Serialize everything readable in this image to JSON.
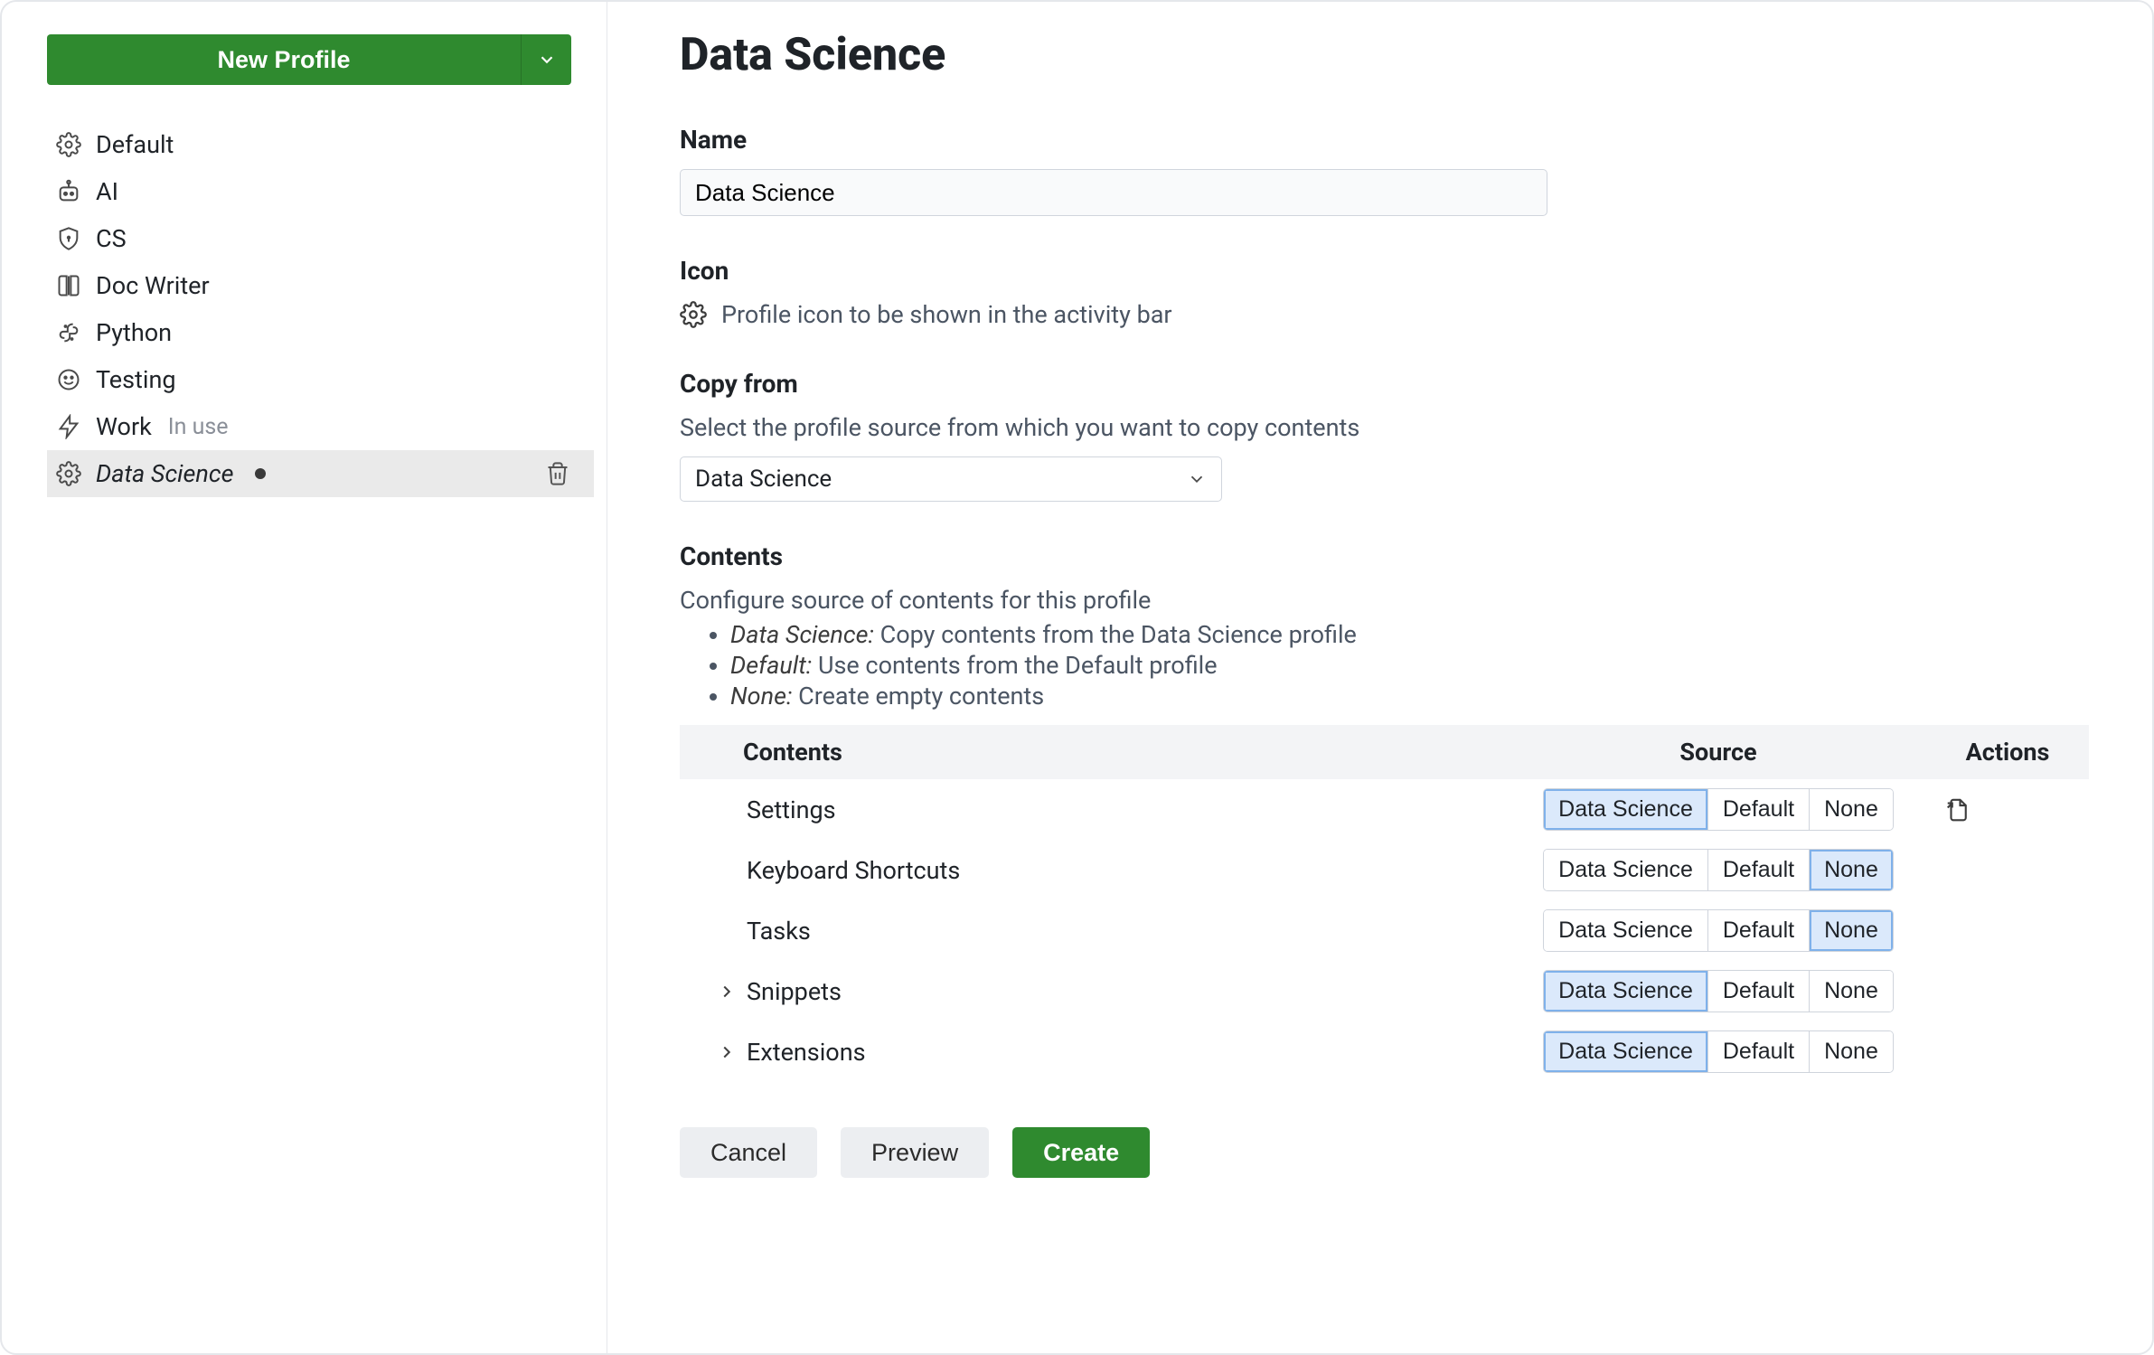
{
  "sidebar": {
    "newProfileLabel": "New Profile",
    "items": [
      {
        "label": "Default",
        "icon": "gear"
      },
      {
        "label": "AI",
        "icon": "robot"
      },
      {
        "label": "CS",
        "icon": "shield"
      },
      {
        "label": "Doc Writer",
        "icon": "book"
      },
      {
        "label": "Python",
        "icon": "snake"
      },
      {
        "label": "Testing",
        "icon": "smile"
      },
      {
        "label": "Work",
        "icon": "bolt",
        "inUse": "In use"
      },
      {
        "label": "Data Science",
        "icon": "gear",
        "selected": true,
        "dirty": true
      }
    ]
  },
  "header": {
    "title": "Data Science"
  },
  "name": {
    "label": "Name",
    "value": "Data Science"
  },
  "icon": {
    "label": "Icon",
    "description": "Profile icon to be shown in the activity bar"
  },
  "copyFrom": {
    "label": "Copy from",
    "description": "Select the profile source from which you want to copy contents",
    "selected": "Data Science"
  },
  "contents": {
    "label": "Contents",
    "description": "Configure source of contents for this profile",
    "legend": [
      {
        "term": "Data Science:",
        "text": " Copy contents from the Data Science profile"
      },
      {
        "term": "Default:",
        "text": " Use contents from the Default profile"
      },
      {
        "term": "None:",
        "text": " Create empty contents"
      }
    ],
    "columns": {
      "contents": "Contents",
      "source": "Source",
      "actions": "Actions"
    },
    "options": [
      "Data Science",
      "Default",
      "None"
    ],
    "rows": [
      {
        "label": "Settings",
        "expandable": false,
        "selected": "Data Science",
        "action": "open-file"
      },
      {
        "label": "Keyboard Shortcuts",
        "expandable": false,
        "selected": "None"
      },
      {
        "label": "Tasks",
        "expandable": false,
        "selected": "None"
      },
      {
        "label": "Snippets",
        "expandable": true,
        "selected": "Data Science"
      },
      {
        "label": "Extensions",
        "expandable": true,
        "selected": "Data Science"
      }
    ]
  },
  "footer": {
    "cancel": "Cancel",
    "preview": "Preview",
    "create": "Create"
  }
}
